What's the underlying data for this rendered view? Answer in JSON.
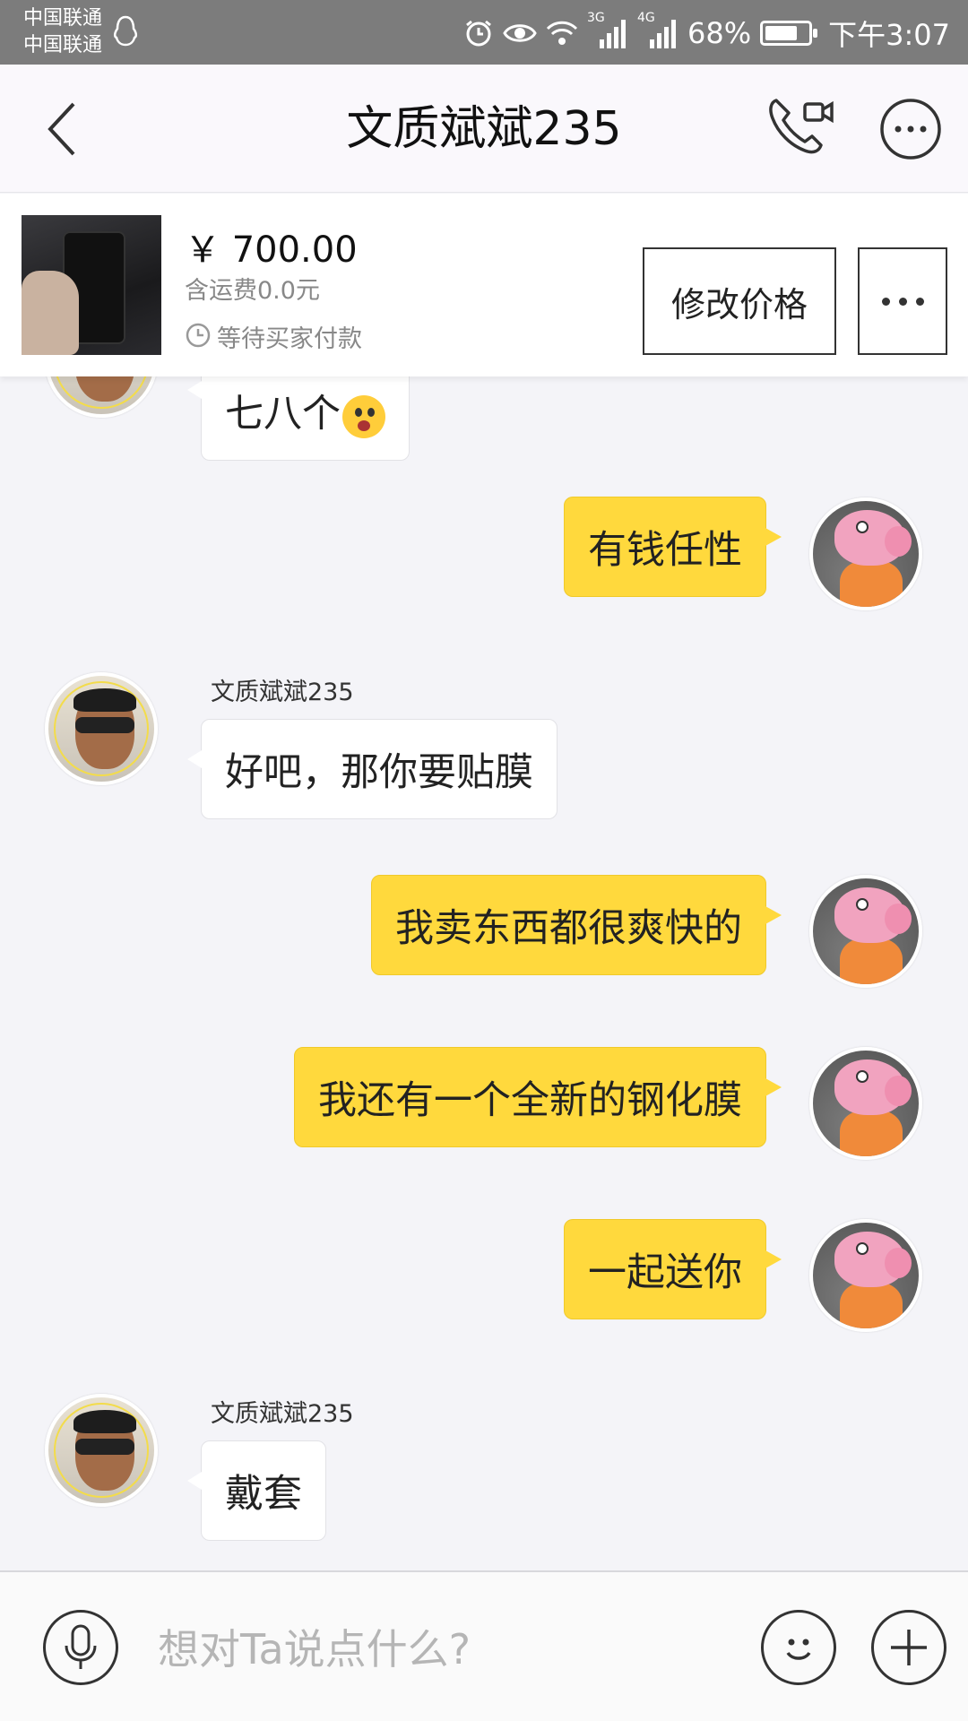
{
  "status_bar": {
    "carrier_1": "中国联通",
    "carrier_2": "中国联通",
    "network_3g": "3G",
    "network_4g": "4G",
    "battery": "68%",
    "battery_level": 0.68,
    "time": "下午3:07"
  },
  "header": {
    "title": "文质斌斌235"
  },
  "product": {
    "price": "￥ 700.00",
    "shipping": "含运费0.0元",
    "status": "等待买家付款",
    "modify_label": "修改价格"
  },
  "messages": [
    {
      "direction": "in",
      "text": "七八个"
    },
    {
      "direction": "out",
      "text": "有钱任性"
    },
    {
      "direction": "in",
      "sender": "文质斌斌235",
      "text": "好吧，那你要贴膜"
    },
    {
      "direction": "out",
      "text": "我卖东西都很爽快的"
    },
    {
      "direction": "out",
      "text": "我还有一个全新的钢化膜"
    },
    {
      "direction": "out",
      "text": "一起送你"
    },
    {
      "direction": "in",
      "sender": "文质斌斌235",
      "text": "戴套"
    }
  ],
  "input": {
    "placeholder": "想对Ta说点什么?"
  },
  "colors": {
    "accent_yellow": "#ffd93d",
    "status_bar_bg": "#7c7c7c",
    "chat_bg": "#f4f4f8"
  },
  "icons": [
    "back-icon",
    "video-call-icon",
    "more-circle-icon",
    "clock-icon",
    "microphone-icon",
    "emoji-icon",
    "plus-icon"
  ]
}
